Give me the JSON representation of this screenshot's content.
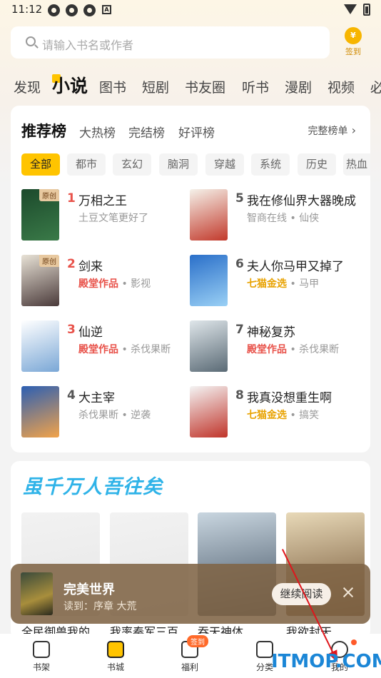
{
  "status_bar": {
    "time": "11:12",
    "a_icon": "A"
  },
  "search": {
    "placeholder": "请输入书名或作者",
    "signin_label": "签到",
    "coin_icon": "¥"
  },
  "tabs": [
    "发现",
    "小说",
    "图书",
    "短剧",
    "书友圈",
    "听书",
    "漫剧",
    "视频",
    "必"
  ],
  "active_tab": "小说",
  "ranking": {
    "title": "推荐榜",
    "sub_tabs": [
      "大热榜",
      "完结榜",
      "好评榜"
    ],
    "all_label": "完整榜单",
    "chips": [
      "全部",
      "都市",
      "玄幻",
      "脑洞",
      "穿越",
      "系统",
      "历史",
      "热血"
    ],
    "books": [
      {
        "num": "1",
        "name": "万相之王",
        "meta": "土豆文笔更好了",
        "tag": "",
        "cover_tag": "原创",
        "cover": [
          "#1c4a2c",
          "#3a7a48"
        ]
      },
      {
        "num": "2",
        "name": "剑来",
        "meta": "影视",
        "tag": "殿堂作品",
        "tag_color": "red",
        "cover_tag": "原创",
        "cover": [
          "#e8e2d6",
          "#4a3a3a"
        ]
      },
      {
        "num": "3",
        "name": "仙逆",
        "meta": "杀伐果断",
        "tag": "殿堂作品",
        "tag_color": "red",
        "cover_tag": "",
        "cover": [
          "#ffffff",
          "#7aa7d6"
        ]
      },
      {
        "num": "4",
        "name": "大主宰",
        "meta": "杀伐果断 • 逆袭",
        "tag": "",
        "cover_tag": "",
        "cover": [
          "#2c5fb3",
          "#f2a34a"
        ]
      },
      {
        "num": "5",
        "name": "我在修仙界大器晚成",
        "meta": "智商在线 • 仙侠",
        "tag": "",
        "cover_tag": "",
        "cover": [
          "#f5f2ea",
          "#c2392b"
        ]
      },
      {
        "num": "6",
        "name": "夫人你马甲又掉了",
        "meta": "马甲",
        "tag": "七猫金选",
        "tag_color": "gold",
        "cover_tag": "",
        "cover": [
          "#2a6fc9",
          "#9ad0f5"
        ]
      },
      {
        "num": "7",
        "name": "神秘复苏",
        "meta": "杀伐果断",
        "tag": "殿堂作品",
        "tag_color": "red",
        "cover_tag": "",
        "cover": [
          "#dfe6ea",
          "#5a6a75"
        ]
      },
      {
        "num": "8",
        "name": "我真没想重生啊",
        "meta": "搞笑",
        "tag": "七猫金选",
        "tag_color": "gold",
        "cover_tag": "",
        "cover": [
          "#f4f4f4",
          "#c0342a"
        ]
      }
    ]
  },
  "recommend": {
    "slogan": "虽千万人吾往矣",
    "books": [
      {
        "title": "全民御兽我的",
        "cover": [
          "#f2f2f2",
          "#e6e6e6"
        ]
      },
      {
        "title": "我率秦军三百",
        "cover": [
          "#f2f2f2",
          "#e6e6e6"
        ]
      },
      {
        "title": "吞天神体",
        "cover": [
          "#c9d6e0",
          "#3b4b5c"
        ]
      },
      {
        "title": "我欲封天",
        "cover": [
          "#e8d9b8",
          "#6a4a2a"
        ]
      }
    ]
  },
  "continue_reading": {
    "title": "完美世界",
    "progress": "读到：序章 大荒",
    "button": "继续阅读"
  },
  "bottom_nav": [
    {
      "label": "书架",
      "icon": "bookshelf-icon"
    },
    {
      "label": "书城",
      "icon": "bookstore-icon"
    },
    {
      "label": "福利",
      "icon": "welfare-icon",
      "badge": "签到"
    },
    {
      "label": "分类",
      "icon": "category-icon"
    },
    {
      "label": "我的",
      "icon": "profile-icon"
    }
  ],
  "watermark": "ITMOP.COM",
  "colors": {
    "accent": "#ffc400",
    "rank_red": "#e8524a",
    "rank_gold": "#e8a200",
    "slogan": "#2fb3e8"
  }
}
